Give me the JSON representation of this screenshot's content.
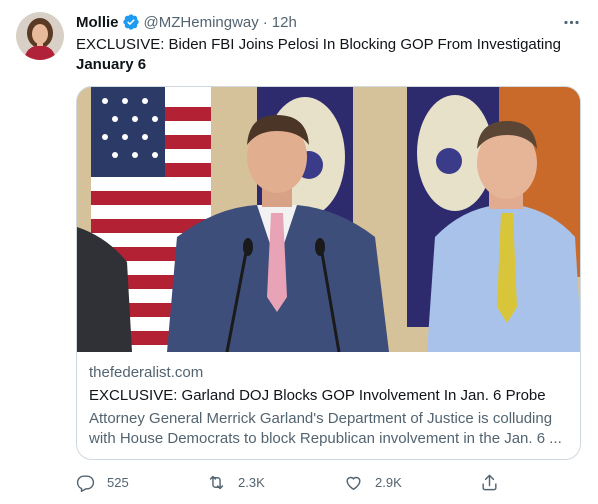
{
  "tweet": {
    "author_name": "Mollie",
    "handle": "@MZHemingway",
    "separator": "·",
    "time": "12h",
    "text_line1": "EXCLUSIVE: Biden FBI Joins Pelosi In Blocking GOP From Investigating",
    "text_line2": "January 6"
  },
  "card": {
    "domain": "thefederalist.com",
    "title": "EXCLUSIVE: Garland DOJ Blocks GOP Involvement In Jan. 6 Probe",
    "description": "Attorney General Merrick Garland's Department of Justice is colluding with House Democrats to block Republican involvement in the Jan. 6 ..."
  },
  "actions": {
    "reply_count": "525",
    "retweet_count": "2.3K",
    "like_count": "2.9K"
  },
  "icons": {
    "verified": "verified-badge-icon",
    "more": "more-icon",
    "reply": "reply-icon",
    "retweet": "retweet-icon",
    "like": "like-icon",
    "share": "share-icon"
  },
  "colors": {
    "verified": "#1d9bf0",
    "secondary_text": "#536471",
    "primary_text": "#0f1419",
    "border": "#cfd9de"
  }
}
